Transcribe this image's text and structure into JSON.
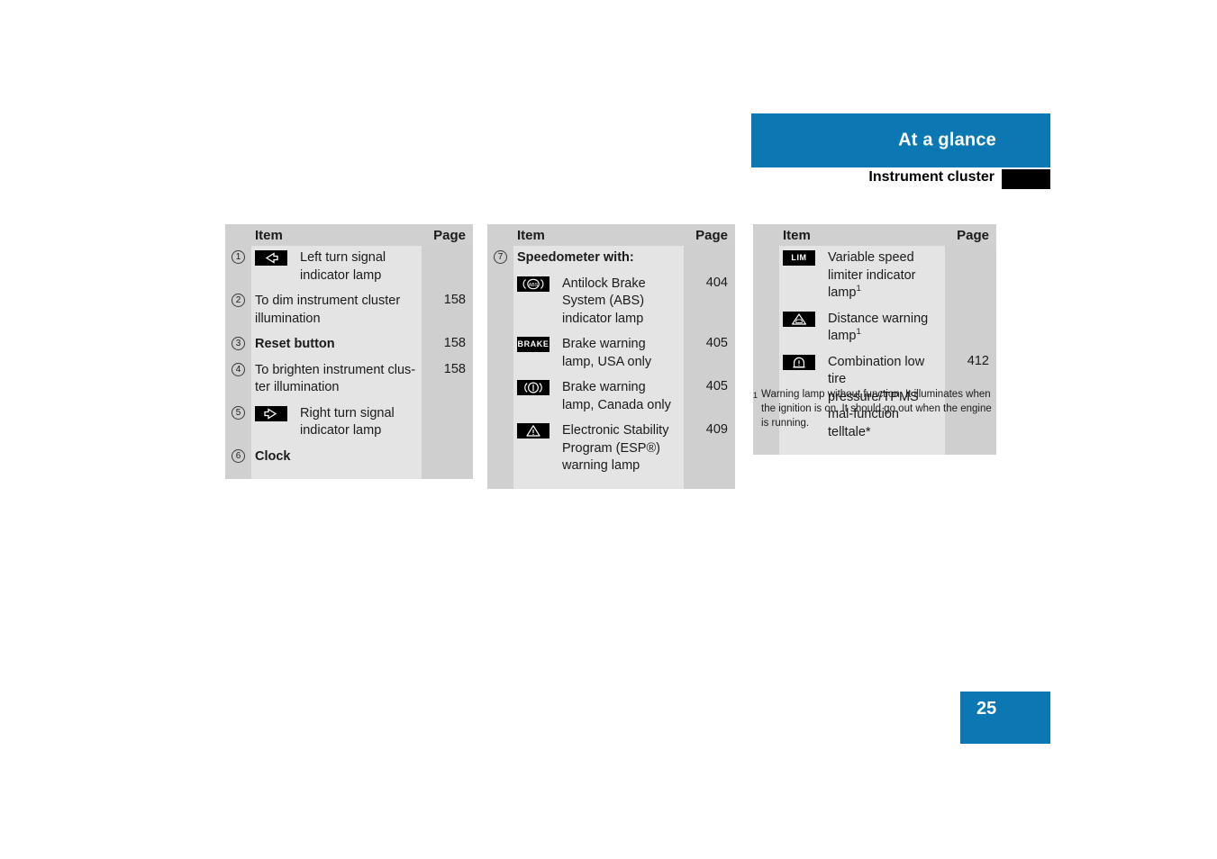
{
  "header": {
    "title": "At a glance",
    "subtitle": "Instrument cluster"
  },
  "columns": {
    "item": "Item",
    "page": "Page"
  },
  "tables": [
    {
      "id": "instrument-cluster-controls",
      "rows": [
        {
          "num": "1",
          "icon": "left-turn-signal-icon",
          "text": "Left turn signal indicator lamp",
          "page": "",
          "bold": false
        },
        {
          "num": "2",
          "icon": "",
          "text": "To dim instrument cluster illumination",
          "page": "158",
          "bold": false
        },
        {
          "num": "3",
          "icon": "",
          "text": "Reset button",
          "page": "158",
          "bold": true
        },
        {
          "num": "4",
          "icon": "",
          "text": "To brighten instrument clus-ter illumination",
          "page": "158",
          "bold": false
        },
        {
          "num": "5",
          "icon": "right-turn-signal-icon",
          "text": "Right turn signal indicator lamp",
          "page": "",
          "bold": false
        },
        {
          "num": "6",
          "icon": "",
          "text": "Clock",
          "page": "",
          "bold": true
        }
      ]
    },
    {
      "id": "speedometer-lamps",
      "rows": [
        {
          "num": "7",
          "icon": "",
          "text": "Speedometer with:",
          "page": "",
          "bold": true
        },
        {
          "num": "",
          "icon": "abs-icon",
          "text": "Antilock Brake System (ABS) indicator lamp",
          "page": "404",
          "bold": false
        },
        {
          "num": "",
          "icon": "brake-usa-icon",
          "text": "Brake warning lamp, USA only",
          "page": "405",
          "bold": false
        },
        {
          "num": "",
          "icon": "brake-canada-icon",
          "text": "Brake warning lamp, Canada only",
          "page": "405",
          "bold": false
        },
        {
          "num": "",
          "icon": "esp-warning-icon",
          "text": "Electronic Stability Program (ESP®) warning lamp",
          "page": "409",
          "bold": false
        }
      ]
    },
    {
      "id": "assistance-lamps",
      "rows": [
        {
          "num": "",
          "icon": "speed-limiter-icon",
          "text": "Variable speed limiter indicator lamp1",
          "page": "",
          "bold": false
        },
        {
          "num": "",
          "icon": "distance-warning-icon",
          "text": "Distance warning lamp1",
          "page": "",
          "bold": false
        },
        {
          "num": "",
          "icon": "tire-pressure-icon",
          "text": "Combination low tire pressure/TPMS mal-function telltale*",
          "page": "412",
          "bold": false
        }
      ]
    }
  ],
  "footnote": {
    "marker": "1",
    "text": "Warning lamp without function. It illuminates when the ignition is on. It should go out when the engine is running."
  },
  "page_number": "25",
  "colors": {
    "brand_blue": "#0b78b4",
    "header_gray": "#d0d0d0",
    "item_gray": "#e4e4e4",
    "page_gray": "#cfcfcf",
    "lamp_black": "#000000"
  }
}
